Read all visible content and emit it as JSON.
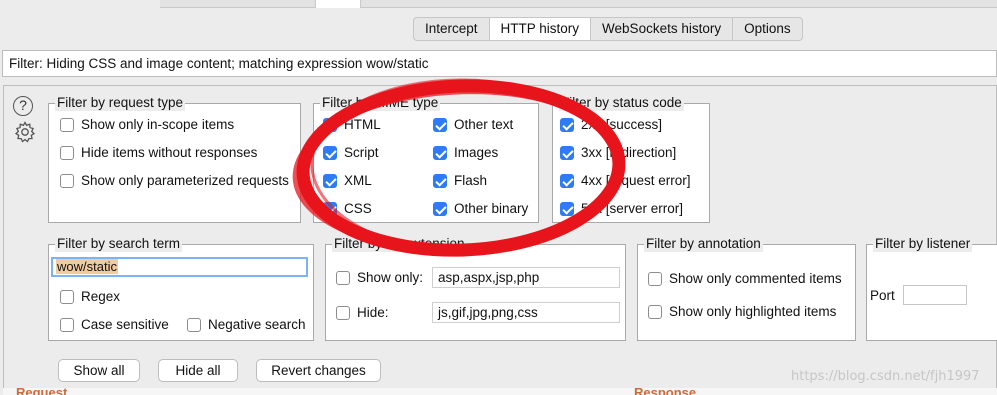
{
  "tabs": [
    {
      "label": "Intercept",
      "active": false
    },
    {
      "label": "HTTP history",
      "active": true
    },
    {
      "label": "WebSockets history",
      "active": false
    },
    {
      "label": "Options",
      "active": false
    }
  ],
  "filter_bar": {
    "text": "Filter: Hiding CSS and image content;  matching expression wow/static"
  },
  "help_icon": {
    "glyph": "?"
  },
  "request_type": {
    "title": "Filter by request type",
    "items": [
      {
        "label": "Show only in-scope items",
        "checked": false
      },
      {
        "label": "Hide items without responses",
        "checked": false
      },
      {
        "label": "Show only parameterized requests",
        "checked": false
      }
    ]
  },
  "mime_type": {
    "title": "Filter by MIME type",
    "items": [
      {
        "label": "HTML",
        "checked": true
      },
      {
        "label": "Script",
        "checked": true
      },
      {
        "label": "XML",
        "checked": true
      },
      {
        "label": "CSS",
        "checked": true
      },
      {
        "label": "Other text",
        "checked": true
      },
      {
        "label": "Images",
        "checked": true
      },
      {
        "label": "Flash",
        "checked": true
      },
      {
        "label": "Other binary",
        "checked": true
      }
    ]
  },
  "status_code": {
    "title": "Filter by status code",
    "items": [
      {
        "label": "2xx  [success]",
        "checked": true
      },
      {
        "label": "3xx  [redirection]",
        "checked": true
      },
      {
        "label": "4xx  [request error]",
        "checked": true
      },
      {
        "label": "5xx  [server error]",
        "checked": true
      }
    ]
  },
  "search_term": {
    "title": "Filter by search term",
    "value": "wow/static",
    "regex": {
      "label": "Regex",
      "checked": false
    },
    "case_sensitive": {
      "label": "Case sensitive",
      "checked": false
    },
    "negative_search": {
      "label": "Negative search",
      "checked": false
    }
  },
  "file_extension": {
    "title": "Filter by file extension",
    "show_only": {
      "label": "Show only:",
      "checked": false,
      "value": "asp,aspx,jsp,php"
    },
    "hide": {
      "label": "Hide:",
      "checked": false,
      "value": "js,gif,jpg,png,css"
    }
  },
  "annotation": {
    "title": "Filter by annotation",
    "commented": {
      "label": "Show only commented items",
      "checked": false
    },
    "highlighted": {
      "label": "Show only highlighted items",
      "checked": false
    }
  },
  "listener": {
    "title": "Filter by listener",
    "port_label": "Port",
    "port_value": ""
  },
  "buttons": {
    "show_all": "Show all",
    "hide_all": "Hide all",
    "revert": "Revert changes"
  },
  "bottom": {
    "request": "Request",
    "response": "Response"
  },
  "watermark": "https://blog.csdn.net/fjh1997",
  "colors": {
    "accent": "#2d7cf6",
    "annotation_ring": "#e8141c",
    "panel_label": "#d06a3a"
  }
}
